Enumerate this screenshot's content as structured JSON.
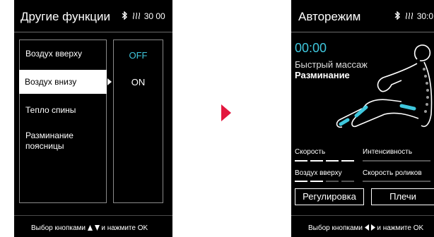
{
  "left_screen": {
    "title": "Другие функции",
    "status": {
      "bluetooth_icon": "bluetooth-icon",
      "heat_icon": "heat-icon",
      "time": "30 00"
    },
    "menu": [
      {
        "label": "Воздух вверху",
        "selected": false
      },
      {
        "label": "Воздух внизу",
        "selected": true
      },
      {
        "label": "Тепло спины",
        "selected": false
      },
      {
        "label": "Разминание поясницы",
        "selected": false
      }
    ],
    "options": [
      {
        "label": "OFF",
        "color": "#3fc7dd"
      },
      {
        "label": "ON",
        "color": "#ffffff"
      }
    ],
    "footer": {
      "prefix": "Выбор кнопками",
      "suffix": "и нажмите OK"
    }
  },
  "arrow_color": "#e3173e",
  "right_screen": {
    "title": "Авторежим",
    "status": {
      "bluetooth_icon": "bluetooth-icon",
      "heat_icon": "heat-icon",
      "time": "30:0"
    },
    "timer": "00:00",
    "program_line1": "Быстрый массаж",
    "program_line2": "Разминание",
    "labels": {
      "speed": "Скорость",
      "intensity": "Интенсивность",
      "air_top": "Воздух вверху",
      "roller_speed": "Скорость роликов"
    },
    "buttons": {
      "adjust": "Регулировка",
      "shoulders": "Плечи"
    },
    "footer": {
      "prefix": "Выбор кнопками",
      "suffix": "и нажмите OK"
    },
    "accent": "#3fc7dd"
  }
}
